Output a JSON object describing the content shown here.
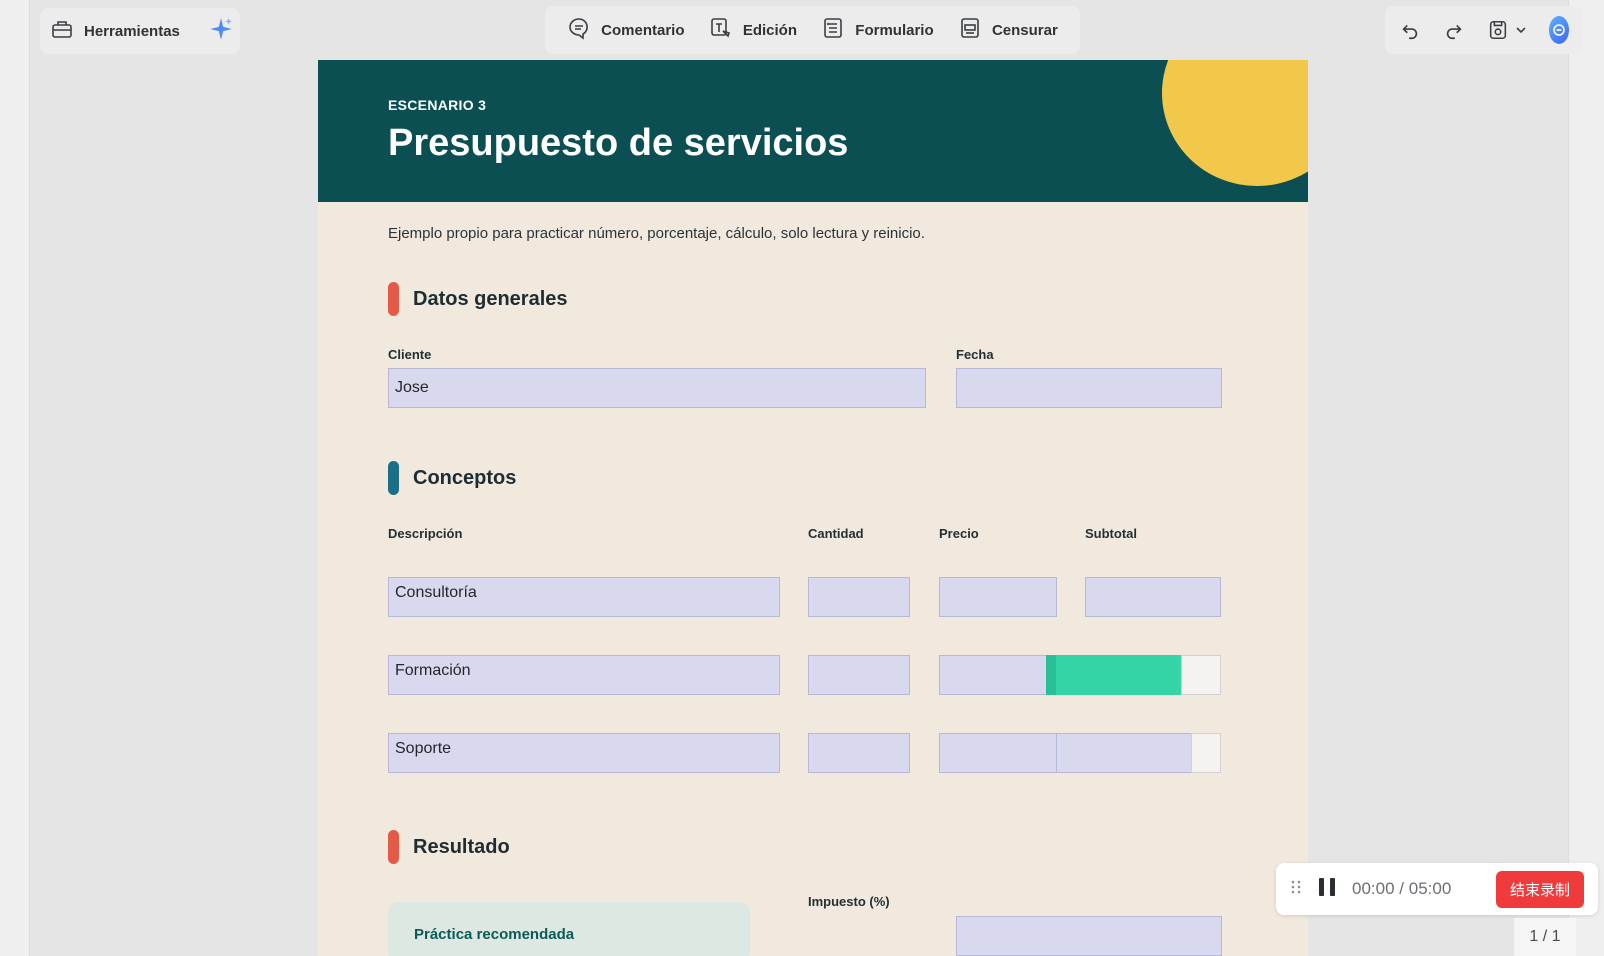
{
  "toolbar": {
    "tools_label": "Herramientas",
    "items": [
      {
        "label": "Comentario",
        "icon": "comment-icon"
      },
      {
        "label": "Edición",
        "icon": "edit-text-icon"
      },
      {
        "label": "Formulario",
        "icon": "form-icon"
      },
      {
        "label": "Censurar",
        "icon": "redact-icon"
      }
    ]
  },
  "header": {
    "kicker": "ESCENARIO 3",
    "title": "Presupuesto de servicios",
    "band_color": "#0b4f52",
    "accent_circle_color": "#f2c84b"
  },
  "intro": "Ejemplo propio para practicar número, porcentaje, cálculo, solo lectura y reinicio.",
  "sections": {
    "general": {
      "title": "Datos generales",
      "bar_color": "#e35b46"
    },
    "concepts": {
      "title": "Conceptos",
      "bar_color": "#1b6f86"
    },
    "result": {
      "title": "Resultado",
      "bar_color": "#e35b46"
    }
  },
  "general_fields": {
    "client_label": "Cliente",
    "client_value": "Jose",
    "date_label": "Fecha",
    "date_value": ""
  },
  "concepts_table": {
    "headers": [
      "Descripción",
      "Cantidad",
      "Precio",
      "Subtotal"
    ],
    "rows": [
      {
        "description": "Consultoría",
        "quantity": "",
        "price": "",
        "subtotal": ""
      },
      {
        "description": "Formación",
        "quantity": "",
        "price": "",
        "subtotal": ""
      },
      {
        "description": "Soporte",
        "quantity": "",
        "price": "",
        "subtotal": ""
      }
    ]
  },
  "result": {
    "tax_label": "Impuesto (%)",
    "recommended_title": "Práctica recomendada"
  },
  "recording": {
    "elapsed": "00:00",
    "separator": "/",
    "total": "05:00",
    "stop_label": "结束录制"
  },
  "pager": "1 / 1"
}
